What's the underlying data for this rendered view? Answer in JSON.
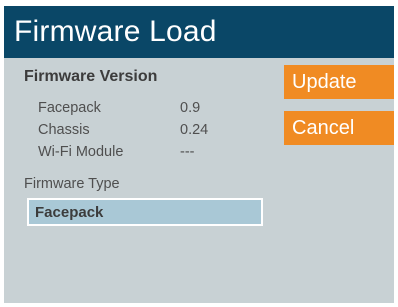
{
  "header": {
    "title": "Firmware Load"
  },
  "version_section": {
    "title": "Firmware Version",
    "rows": [
      {
        "label": "Facepack",
        "value": "0.9"
      },
      {
        "label": "Chassis",
        "value": "0.24"
      },
      {
        "label": "Wi-Fi Module",
        "value": "---"
      }
    ]
  },
  "firmware_type": {
    "label": "Firmware Type",
    "value": "Facepack"
  },
  "buttons": {
    "update": "Update",
    "cancel": "Cancel"
  },
  "colors": {
    "header_bg": "#0a4767",
    "panel_bg": "#c8d1d4",
    "button_bg": "#f08b23",
    "field_bg": "#a9c8d6"
  }
}
